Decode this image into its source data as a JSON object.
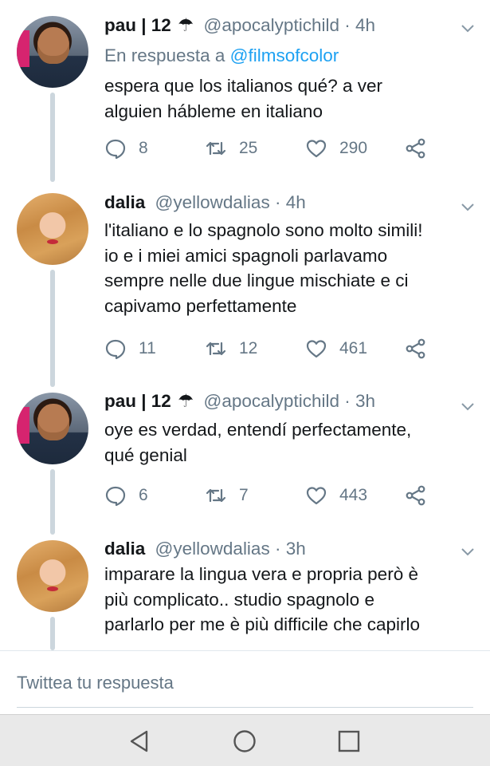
{
  "tweets": [
    {
      "name": "pau | 12",
      "umbrella": "☂",
      "handle": "@apocalyptichild · 4h",
      "reply_prefix": "En respuesta a",
      "reply_mention": "@filmsofcolor",
      "text_lines": [
        "espera que los italianos qué? a ver",
        "alguien hábleme en italiano"
      ],
      "replies": "8",
      "retweets": "25",
      "likes": "290"
    },
    {
      "name": "dalia",
      "handle": "@yellowdalias · 4h",
      "text_lines": [
        "l'italiano e lo spagnolo sono molto simili!",
        "io e i miei amici spagnoli parlavamo",
        "sempre nelle due lingue mischiate e ci",
        "capivamo perfettamente"
      ],
      "replies": "11",
      "retweets": "12",
      "likes": "461"
    },
    {
      "name": "pau | 12",
      "umbrella": "☂",
      "handle": "@apocalyptichild · 3h",
      "text_lines": [
        "oye es verdad, entendí perfectamente,",
        "qué genial"
      ],
      "replies": "6",
      "retweets": "7",
      "likes": "443"
    },
    {
      "name": "dalia",
      "handle": "@yellowdalias · 3h",
      "text_lines": [
        "imparare la lingua vera e propria però è",
        "più complicato.. studio spagnolo e",
        "parlarlo per me è più difficile che capirlo"
      ]
    }
  ],
  "composer": {
    "placeholder": "Twittea tu respuesta"
  },
  "navbar": {
    "buttons": [
      "back-icon",
      "home-icon",
      "recents-icon"
    ]
  },
  "colors": {
    "accent": "#1da1f2",
    "secondary_text": "#657786",
    "thread_line": "#ccd6dd"
  }
}
